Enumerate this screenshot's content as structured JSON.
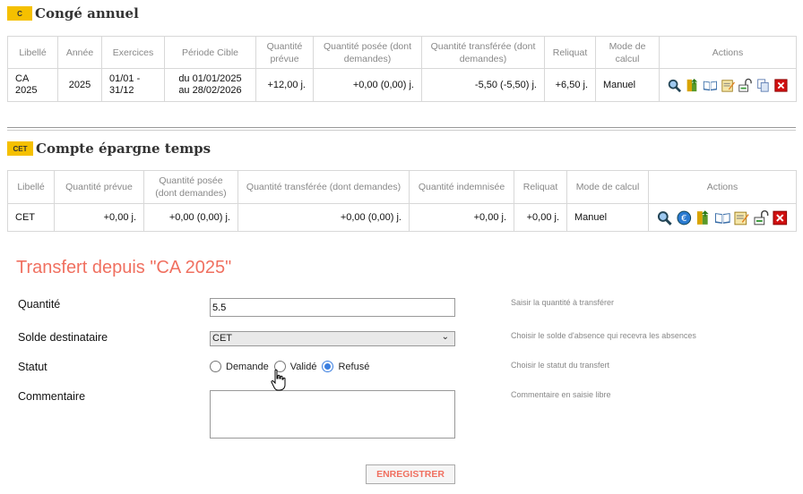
{
  "sections": {
    "conge": {
      "badge": "C",
      "title": "Congé annuel"
    },
    "cet": {
      "badge": "CET",
      "title": "Compte épargne temps"
    }
  },
  "table_conge": {
    "headers": [
      "Libellé",
      "Année",
      "Exercices",
      "Période Cible",
      "Quantité prévue",
      "Quantité posée (dont demandes)",
      "Quantité transférée (dont demandes)",
      "Reliquat",
      "Mode de calcul",
      "Actions"
    ],
    "row": {
      "libelle": "CA 2025",
      "annee": "2025",
      "exercices": "01/01 - 31/12",
      "periode": "du 01/01/2025 au 28/02/2026",
      "prevue": "+12,00 j.",
      "posee": "+0,00 (0,00) j.",
      "transferee": "-5,50 (-5,50) j.",
      "reliquat": "+6,50 j.",
      "mode": "Manuel"
    },
    "actions": [
      "search-icon",
      "transfer-icon",
      "book-icon",
      "edit-note-icon",
      "lock-open-icon",
      "copy-icon",
      "delete-icon"
    ]
  },
  "table_cet": {
    "headers": [
      "Libellé",
      "Quantité prévue",
      "Quantité posée (dont demandes)",
      "Quantité transférée (dont demandes)",
      "Quantité indemnisée",
      "Reliquat",
      "Mode de calcul",
      "Actions"
    ],
    "row": {
      "libelle": "CET",
      "prevue": "+0,00 j.",
      "posee": "+0,00 (0,00) j.",
      "transferee": "+0,00 (0,00) j.",
      "indemnisee": "+0,00 j.",
      "reliquat": "+0,00 j.",
      "mode": "Manuel"
    },
    "actions": [
      "search-icon",
      "euro-icon",
      "transfer-icon",
      "book-icon",
      "edit-note-icon",
      "lock-open-icon",
      "delete-icon"
    ]
  },
  "form": {
    "title": "Transfert depuis \"CA 2025\"",
    "quantite": {
      "label": "Quantité",
      "value": "5.5",
      "help": "Saisir la quantité à transférer"
    },
    "solde": {
      "label": "Solde destinataire",
      "value": "CET",
      "help": "Choisir le solde d'absence qui recevra les absences"
    },
    "statut": {
      "label": "Statut",
      "options": [
        "Demande",
        "Validé",
        "Refusé"
      ],
      "selected": "Refusé",
      "help": "Choisir le statut du transfert"
    },
    "commentaire": {
      "label": "Commentaire",
      "help": "Commentaire en saisie libre"
    },
    "save_label": "ENREGISTRER"
  },
  "colors": {
    "badge": "#f5c000",
    "accent": "#f07060",
    "radio_selected": "#3b7fe0",
    "orange_value": "#f0a020"
  }
}
